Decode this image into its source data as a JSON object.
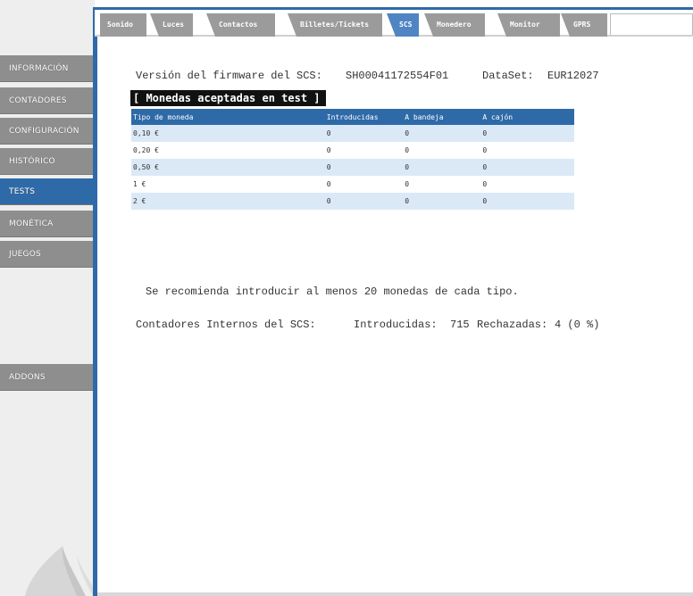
{
  "sidebar": {
    "items": [
      {
        "label": "INFORMACIÓN",
        "active": false
      },
      {
        "label": "CONTADORES",
        "active": false
      },
      {
        "label": "CONFIGURACIÓN",
        "active": false
      },
      {
        "label": "HISTÓRICO",
        "active": false
      },
      {
        "label": "TESTS",
        "active": true
      },
      {
        "label": "MONÉTICA",
        "active": false
      },
      {
        "label": "JUEGOS",
        "active": false
      },
      {
        "label": "ADDONS",
        "active": false
      }
    ]
  },
  "tabs": [
    {
      "label": "Sonido",
      "active": false
    },
    {
      "label": "Luces",
      "active": false
    },
    {
      "label": "Contactos",
      "active": false
    },
    {
      "label": "Billetes/Tickets",
      "active": false
    },
    {
      "label": "SCS",
      "active": true
    },
    {
      "label": "Monedero",
      "active": false
    },
    {
      "label": "Monitor",
      "active": false
    },
    {
      "label": "GPRS",
      "active": false
    }
  ],
  "info": {
    "firmware_label": "Versión del firmware del SCS:",
    "firmware_value": "SH00041172554F01",
    "dataset_label": "DataSet:",
    "dataset_value": "EUR12027"
  },
  "section_title": "[ Monedas aceptadas en test ]",
  "table": {
    "headers": [
      "Tipo de moneda",
      "Introducidas",
      "A bandeja",
      "A cajón"
    ],
    "rows": [
      [
        "0,10 €",
        "0",
        "0",
        "0"
      ],
      [
        "0,20 €",
        "0",
        "0",
        "0"
      ],
      [
        "0,50 €",
        "0",
        "0",
        "0"
      ],
      [
        "1 €",
        "0",
        "0",
        "0"
      ],
      [
        "2 €",
        "0",
        "0",
        "0"
      ]
    ]
  },
  "recommendation": "Se recomienda introducir al menos 20 monedas de cada tipo.",
  "counters": {
    "label": "Contadores Internos del SCS:",
    "introducidas_label": "Introducidas:",
    "introducidas_value": "715",
    "rechazadas_label": "Rechazadas:",
    "rechazadas_value": "4 (0 %)"
  },
  "colors": {
    "accent": "#2e6aa8",
    "sidebar_button": "#8e8e8e",
    "tab_inactive": "#9b9b9b",
    "tab_active": "#4f85c3",
    "row_alt": "#dbe9f7"
  },
  "logo": {
    "icon": "water-drop-logo"
  }
}
